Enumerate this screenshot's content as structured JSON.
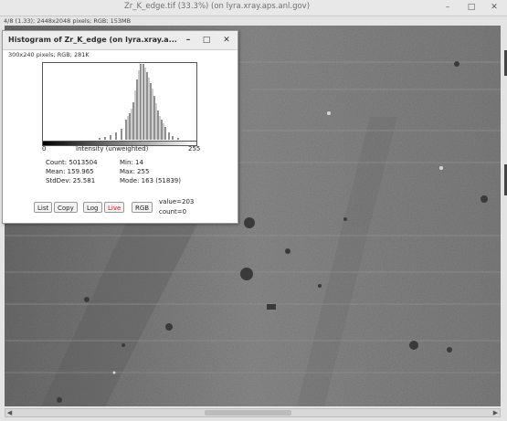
{
  "main_window": {
    "title": "Zr_K_edge.tif (33.3%) (on lyra.xray.aps.anl.gov)",
    "controls": {
      "minimize": "–",
      "maximize": "□",
      "close": "✕"
    },
    "info": "4/8 (1.33); 2448x2048 pixels; RGB; 153MB"
  },
  "histogram_window": {
    "title": "Histogram of Zr_K_edge (on lyra.xray.a...",
    "controls": {
      "minimize": "–",
      "maximize": "□",
      "close": "✕"
    },
    "subtitle": "300x240 pixels; RGB; 281K",
    "axis": {
      "min_label": "0",
      "max_label": "255",
      "center_label": "Intensity (unweighted)"
    },
    "stats": {
      "count_label": "Count: 5013504",
      "mean_label": "Mean: 159.965",
      "stddev_label": "StdDev: 25.581",
      "min_label": "Min: 14",
      "max_label": "Max: 255",
      "mode_label": "Mode: 163 (51839)"
    },
    "buttons": {
      "list": "List",
      "copy": "Copy",
      "log": "Log",
      "live": "Live",
      "rgb": "RGB"
    },
    "value_label": "value=203",
    "count_label": "count=0",
    "live_color": "#d21d1d"
  }
}
